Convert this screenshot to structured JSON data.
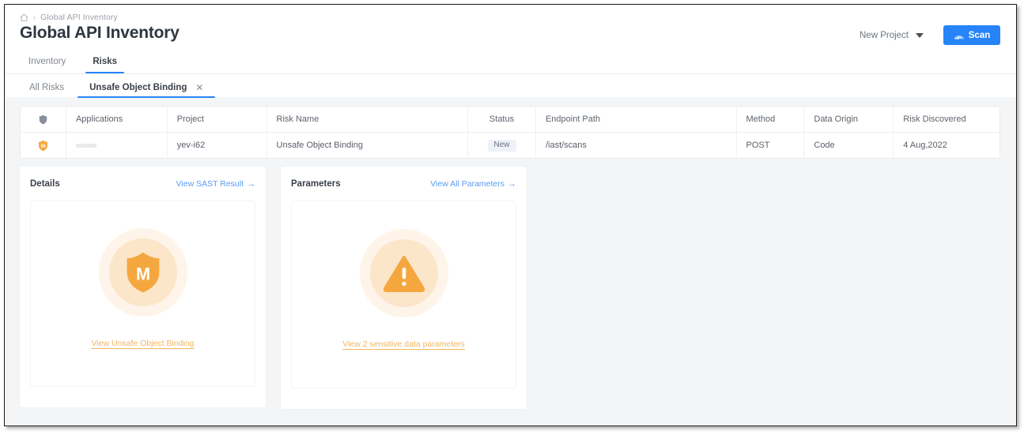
{
  "breadcrumb": {
    "home_icon": "home-icon",
    "separator": "›",
    "current": "Global API Inventory"
  },
  "header": {
    "title": "Global API Inventory",
    "project_selector": {
      "label": "New Project",
      "caret_icon": "chevron-down-icon"
    },
    "scan_button": {
      "label": "Scan",
      "icon": "radar-scan-icon",
      "color": "#2684f8"
    }
  },
  "primary_tabs": [
    {
      "label": "Inventory",
      "active": false
    },
    {
      "label": "Risks",
      "active": true
    }
  ],
  "secondary_tabs": [
    {
      "label": "All Risks",
      "active": false,
      "closable": false
    },
    {
      "label": "Unsafe Object Binding",
      "active": true,
      "closable": true,
      "close_icon": "close-icon"
    }
  ],
  "table": {
    "columns": [
      {
        "key": "severity",
        "label": "",
        "icon": "shield-icon"
      },
      {
        "key": "applications",
        "label": "Applications"
      },
      {
        "key": "project",
        "label": "Project"
      },
      {
        "key": "risk_name",
        "label": "Risk Name"
      },
      {
        "key": "status",
        "label": "Status"
      },
      {
        "key": "endpoint_path",
        "label": "Endpoint Path"
      },
      {
        "key": "method",
        "label": "Method"
      },
      {
        "key": "data_origin",
        "label": "Data Origin"
      },
      {
        "key": "risk_discovered",
        "label": "Risk Discovered"
      }
    ],
    "rows": [
      {
        "severity_icon": "shield-medium-icon",
        "severity_letter": "M",
        "applications": "",
        "project": "yev-i62",
        "risk_name": "Unsafe Object Binding",
        "status": "New",
        "endpoint_path": "/iast/scans",
        "method": "POST",
        "data_origin": "Code",
        "risk_discovered": "4 Aug,2022"
      }
    ]
  },
  "cards": [
    {
      "title": "Details",
      "link_label": "View SAST Result",
      "link_arrow": "→",
      "illustration_icon": "shield-medium-icon",
      "illustration_letter": "M",
      "inner_link": "View Unsafe Object Binding"
    },
    {
      "title": "Parameters",
      "link_label": "View All Parameters",
      "link_arrow": "→",
      "illustration_icon": "warning-triangle-icon",
      "inner_link": "View 2 sensitive data parameters"
    }
  ],
  "colors": {
    "accent_blue": "#2684f8",
    "link_blue": "#5b9bf3",
    "severity_orange": "#f5a73f",
    "orange_link": "#f5b55c",
    "badge_bg": "#eef1f7",
    "page_bg": "#f4f5f7"
  }
}
